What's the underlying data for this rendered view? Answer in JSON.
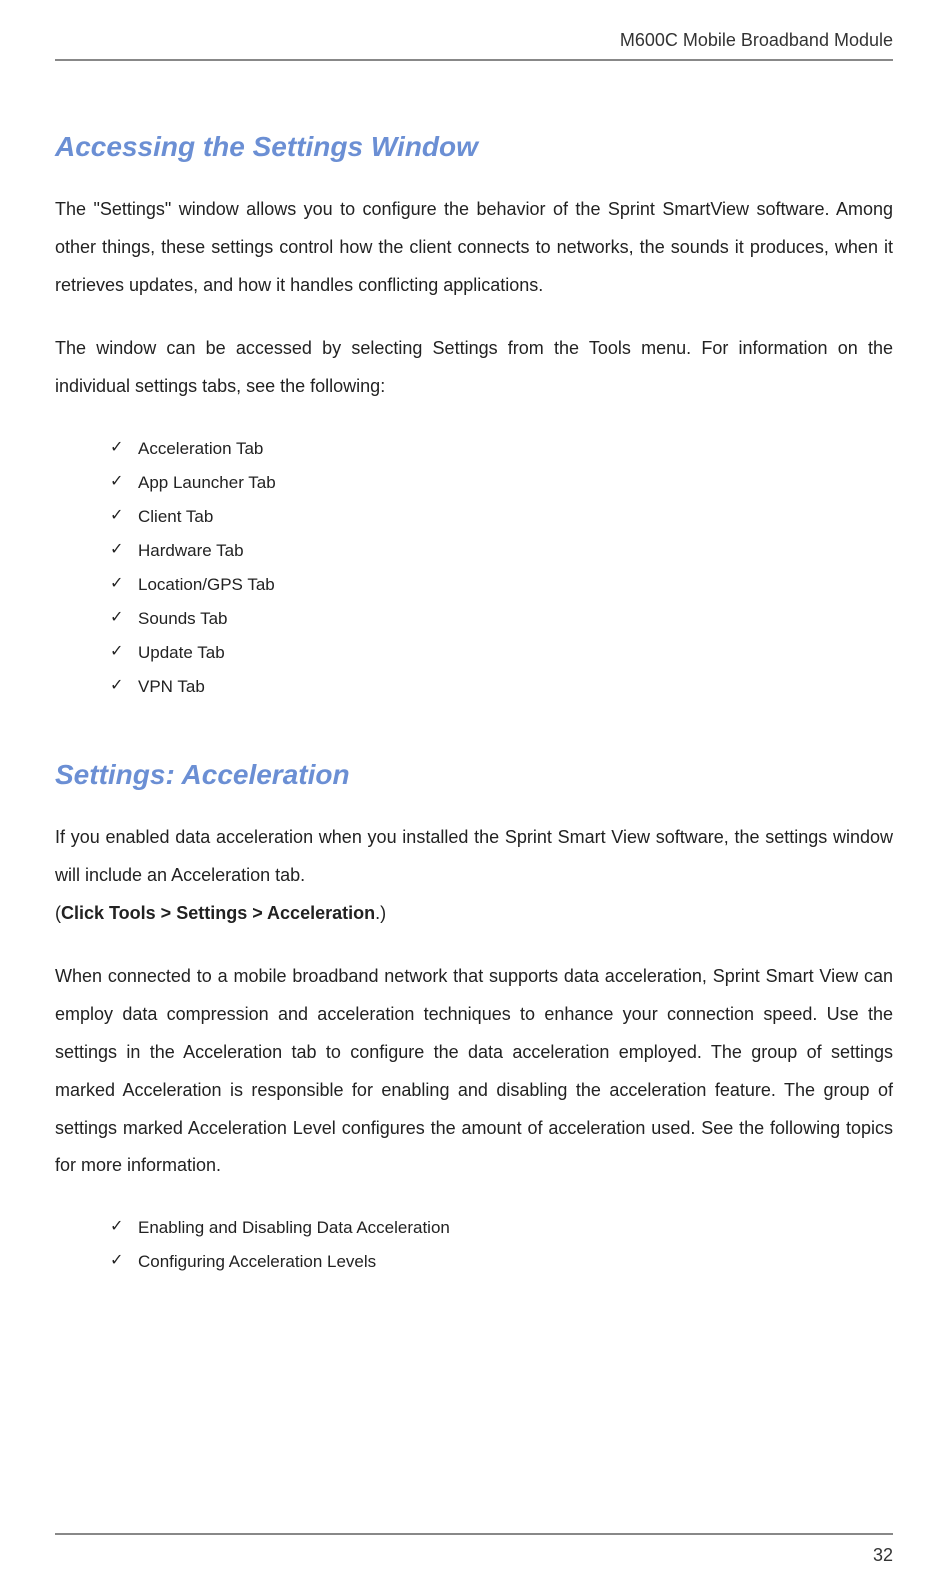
{
  "header": {
    "title": "M600C Mobile Broadband Module"
  },
  "section1": {
    "heading": "Accessing the Settings Window",
    "para1": "The \"Settings\" window allows you to configure the behavior of the Sprint SmartView software. Among other things, these settings control how the client connects to networks, the sounds it produces, when it retrieves updates, and how it handles conflicting applications.",
    "para2": "The window can be accessed by selecting Settings from the Tools menu. For information on the individual settings tabs, see the following:",
    "list": [
      "Acceleration Tab",
      "App Launcher Tab",
      "Client Tab",
      "Hardware Tab",
      "Location/GPS Tab",
      "Sounds Tab",
      "Update Tab",
      "VPN Tab"
    ]
  },
  "section2": {
    "heading": "Settings: Acceleration",
    "para1": "If you enabled data acceleration when you installed the Sprint Smart View software, the settings window will include an Acceleration tab.",
    "para2_open": "(",
    "para2_bold": "Click Tools > Settings > Acceleration",
    "para2_close": ".)",
    "para3": "When connected to a mobile broadband network that supports data acceleration, Sprint Smart View can employ data compression and acceleration techniques to enhance your connection speed. Use the settings in the Acceleration tab to configure the data acceleration employed. The group of settings marked Acceleration is responsible for enabling and disabling the acceleration feature. The group of settings marked Acceleration Level configures the amount of acceleration used. See the following topics for more information.",
    "list": [
      "Enabling and Disabling Data Acceleration",
      "Configuring Acceleration Levels"
    ]
  },
  "footer": {
    "page": "32"
  }
}
